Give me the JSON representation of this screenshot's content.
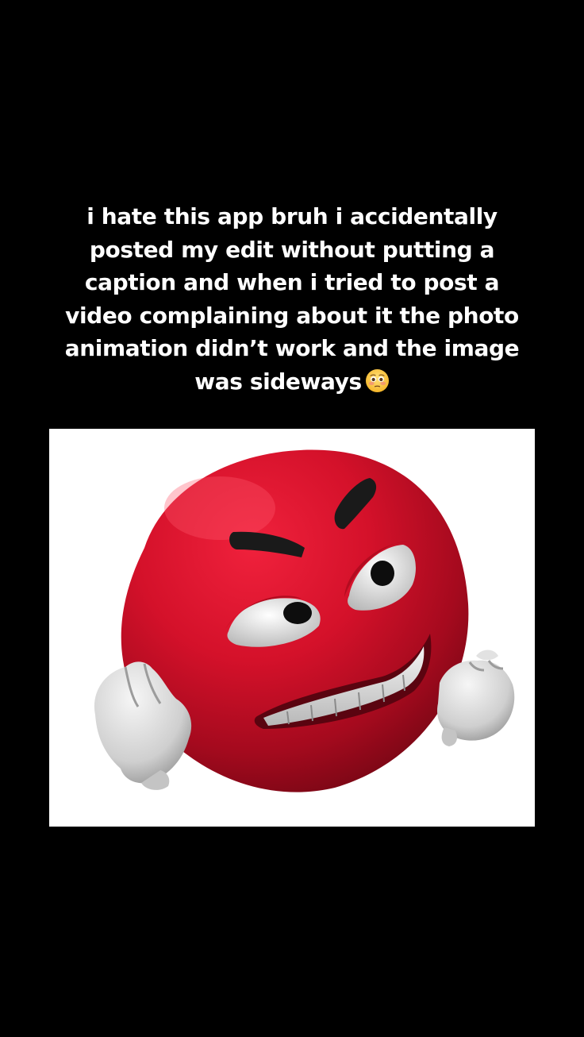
{
  "caption": {
    "lines": [
      "i hate this app bruh i accidentally",
      "posted my edit without putting a",
      "caption and when i tried to post a",
      "video complaining about it the photo",
      "animation didn’t work and the image",
      "was sideways"
    ],
    "emoji": "flushed-face"
  },
  "image": {
    "subject": "angry-red-face",
    "background": "#ffffff",
    "face_color": "#d4112a"
  }
}
